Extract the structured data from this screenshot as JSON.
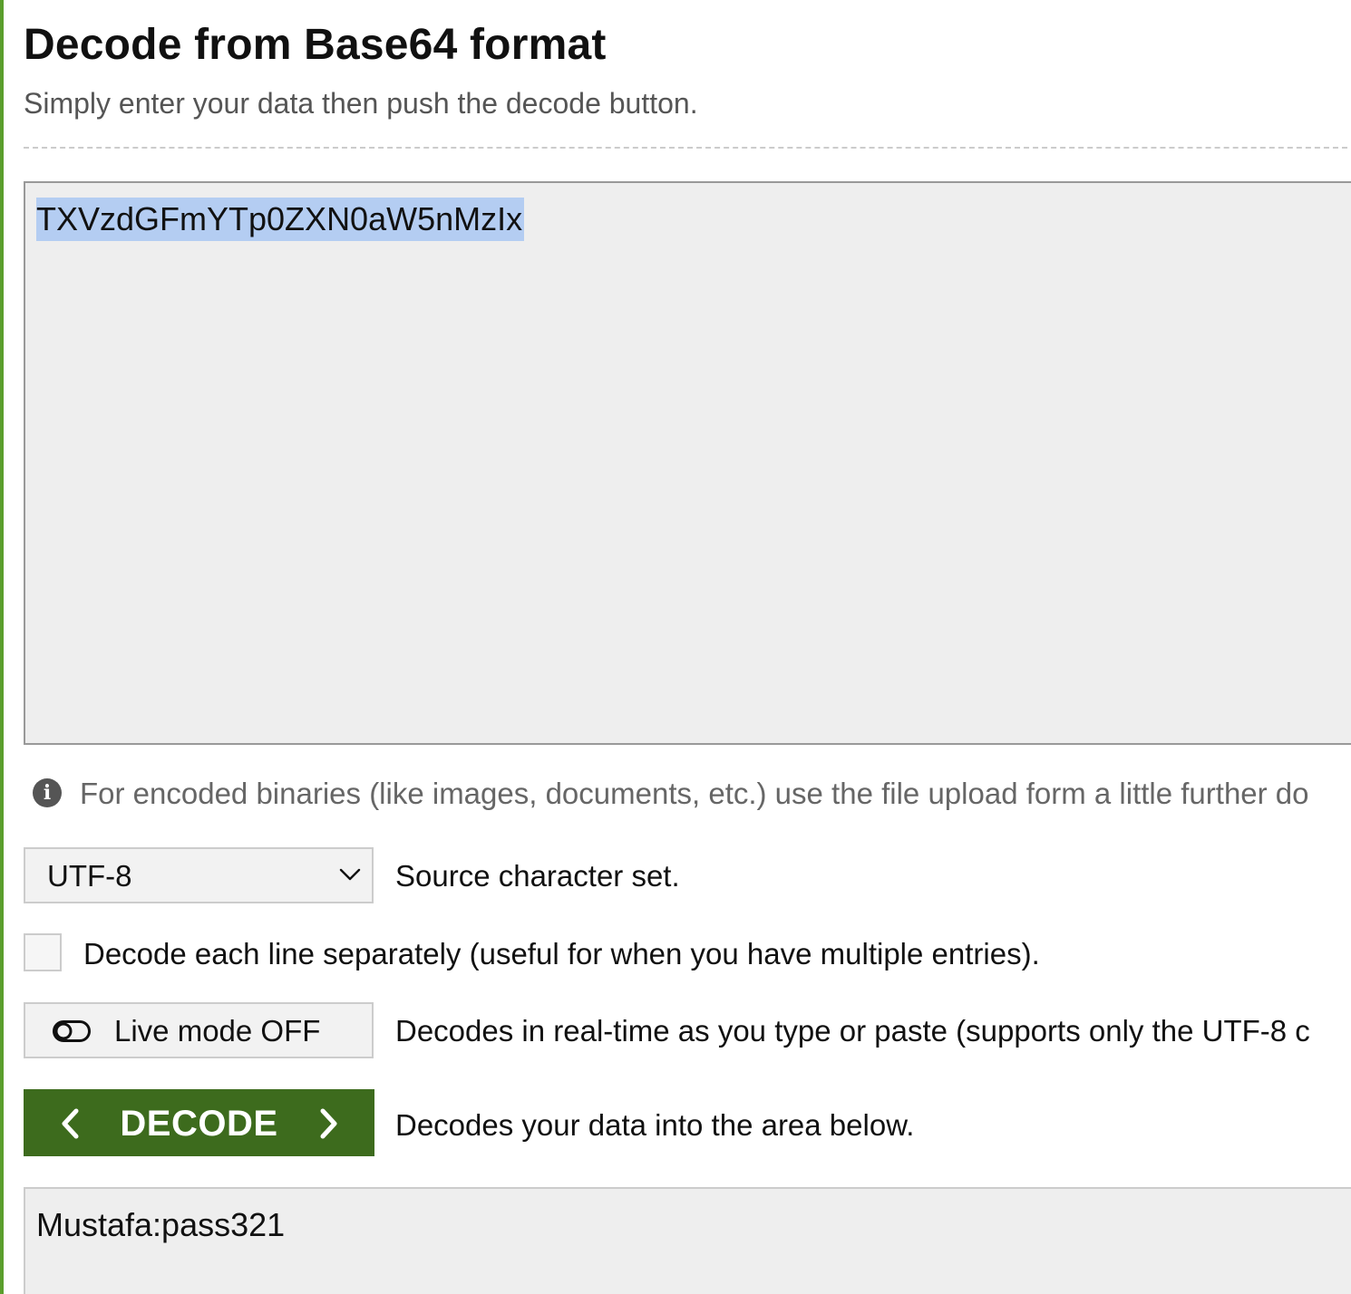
{
  "page": {
    "title": "Decode from Base64 format",
    "subtitle": "Simply enter your data then push the decode button."
  },
  "input": {
    "value": "TXVzdGFmYTp0ZXN0aW5nMzIx",
    "selected": true
  },
  "info": {
    "icon": "info-icon",
    "text": "For encoded binaries (like images, documents, etc.) use the file upload form a little further do"
  },
  "charset": {
    "selected": "UTF-8",
    "label": "Source character set."
  },
  "line_separately": {
    "checked": false,
    "label": "Decode each line separately (useful for when you have multiple entries)."
  },
  "live_mode": {
    "icon": "toggle-off-icon",
    "label": "Live mode OFF",
    "description": "Decodes in real-time as you type or paste (supports only the UTF-8 c"
  },
  "decode": {
    "label": "DECODE",
    "description": "Decodes your data into the area below."
  },
  "output": {
    "value": "Mustafa:pass321"
  },
  "colors": {
    "accent": "#5a9e2c",
    "decode_button": "#3d6b1d",
    "selection": "#b4cdf2",
    "field_background": "#eeeeee"
  }
}
